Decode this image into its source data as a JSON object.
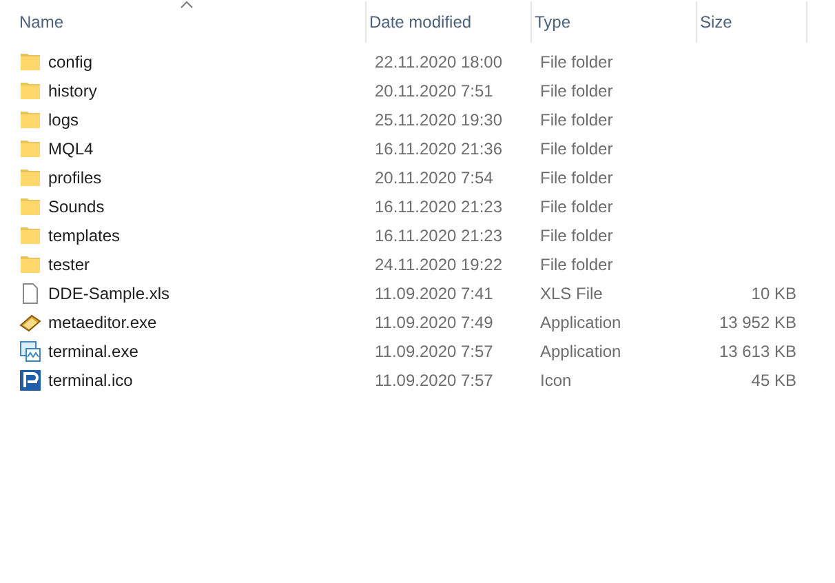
{
  "columns": [
    {
      "label": "Name",
      "sorted": true
    },
    {
      "label": "Date modified",
      "sorted": false
    },
    {
      "label": "Type",
      "sorted": false
    },
    {
      "label": "Size",
      "sorted": false
    }
  ],
  "rows": [
    {
      "kind": "folder",
      "name": "config",
      "date": "22.11.2020 18:00",
      "type": "File folder"
    },
    {
      "kind": "folder",
      "name": "history",
      "date": "20.11.2020 7:51",
      "type": "File folder"
    },
    {
      "kind": "folder",
      "name": "logs",
      "date": "25.11.2020 19:30",
      "type": "File folder"
    },
    {
      "kind": "folder",
      "name": "MQL4",
      "date": "16.11.2020 21:36",
      "type": "File folder"
    },
    {
      "kind": "folder",
      "name": "profiles",
      "date": "20.11.2020 7:54",
      "type": "File folder"
    },
    {
      "kind": "folder",
      "name": "Sounds",
      "date": "16.11.2020 21:23",
      "type": "File folder"
    },
    {
      "kind": "folder",
      "name": "templates",
      "date": "16.11.2020 21:23",
      "type": "File folder"
    },
    {
      "kind": "folder",
      "name": "tester",
      "date": "24.11.2020 19:22",
      "type": "File folder"
    },
    {
      "kind": "document",
      "name": "DDE-Sample.xls",
      "date": "11.09.2020 7:41",
      "type": "XLS File",
      "size": "10 KB"
    },
    {
      "kind": "book",
      "name": "metaeditor.exe",
      "date": "11.09.2020 7:49",
      "type": "Application",
      "size": "13 952 KB"
    },
    {
      "kind": "window",
      "name": "terminal.exe",
      "date": "11.09.2020 7:57",
      "type": "Application",
      "size": "13 613 KB"
    },
    {
      "kind": "logo",
      "name": "terminal.ico",
      "date": "11.09.2020 7:57",
      "type": "Icon",
      "size": "45 KB"
    }
  ]
}
